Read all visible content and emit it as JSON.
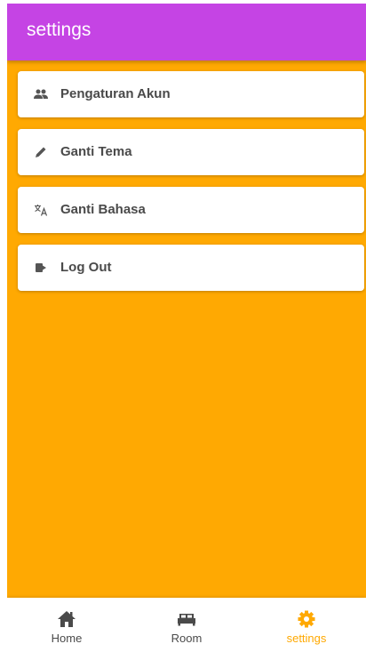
{
  "colors": {
    "app_bar": "#C544E4",
    "background": "#FFA902",
    "active_nav": "#FFA902",
    "card": "#FFFFFF",
    "text": "#4A4A4A"
  },
  "app_bar": {
    "title": "settings"
  },
  "menu": {
    "items": [
      {
        "label": "Pengaturan Akun",
        "icon": "people-icon"
      },
      {
        "label": "Ganti Tema",
        "icon": "pencil-icon"
      },
      {
        "label": "Ganti Bahasa",
        "icon": "translate-icon"
      },
      {
        "label": "Log Out",
        "icon": "logout-icon"
      }
    ]
  },
  "bottom_nav": {
    "items": [
      {
        "label": "Home",
        "icon": "home-icon",
        "active": false
      },
      {
        "label": "Room",
        "icon": "bed-icon",
        "active": false
      },
      {
        "label": "settings",
        "icon": "gear-icon",
        "active": true
      }
    ]
  }
}
